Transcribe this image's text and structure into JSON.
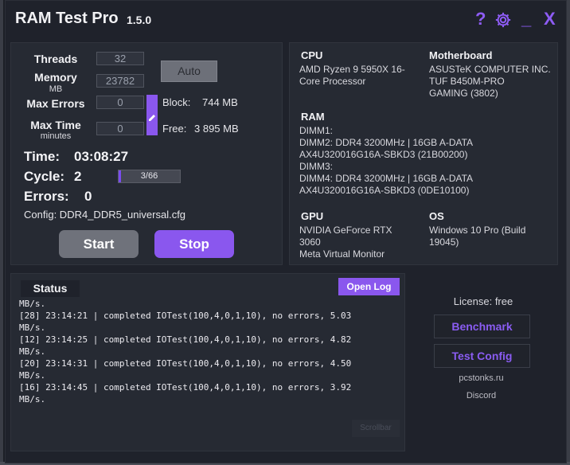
{
  "app": {
    "title": "RAM Test Pro",
    "version": "1.5.0",
    "accent": "#8a57ee",
    "icons": {
      "help": "?",
      "settings": "gear-icon",
      "minimize": "_",
      "close": "X"
    }
  },
  "controls": {
    "threads_label": "Threads",
    "threads_value": "32",
    "memory_label": "Memory",
    "memory_unit": "MB",
    "memory_value": "23782",
    "max_errors_label": "Max Errors",
    "max_errors_value": "0",
    "max_time_label": "Max Time",
    "max_time_unit": "minutes",
    "max_time_value": "0",
    "auto_label": "Auto",
    "block_label": "Block:",
    "block_value": "744 MB",
    "free_label": "Free:",
    "free_value": "3 895 MB"
  },
  "run": {
    "time_label": "Time:",
    "time_value": "03:08:27",
    "cycle_label": "Cycle:",
    "cycle_value": "2",
    "progress_text": "3/66",
    "progress_fraction": 0.045,
    "errors_label": "Errors:",
    "errors_value": "0",
    "config": "Config: DDR4_DDR5_universal.cfg",
    "start_label": "Start",
    "stop_label": "Stop"
  },
  "system": {
    "cpu_label": "CPU",
    "cpu_value": [
      "AMD Ryzen 9 5950X 16-",
      "Core Processor"
    ],
    "mb_label": "Motherboard",
    "mb_value": [
      "ASUSTeK COMPUTER INC.",
      "TUF B450M-PRO",
      "GAMING (3802)"
    ],
    "ram_label": "RAM",
    "ram_value": [
      "DIMM1:",
      "DIMM2: DDR4 3200MHz | 16GB A-DATA",
      "AX4U320016G16A-SBKD3 (21B00200)",
      "DIMM3:",
      "DIMM4: DDR4 3200MHz | 16GB A-DATA",
      "AX4U320016G16A-SBKD3 (0DE10100)"
    ],
    "gpu_label": "GPU",
    "gpu_value": [
      "NVIDIA GeForce RTX",
      "3060",
      "Meta Virtual Monitor"
    ],
    "os_label": "OS",
    "os_value": [
      "Windows 10 Pro (Build",
      "19045)"
    ]
  },
  "status": {
    "title": "Status",
    "open_log_label": "Open Log",
    "scrollbar_label": "Scrollbar",
    "log_lines": [
      "MB/s.",
      "[28] 23:14:21 | completed IOTest(100,4,0,1,10), no errors, 5.03",
      "MB/s.",
      "[12] 23:14:25 | completed IOTest(100,4,0,1,10), no errors, 4.82",
      "MB/s.",
      "[20] 23:14:31 | completed IOTest(100,4,0,1,10), no errors, 4.50",
      "MB/s.",
      "[16] 23:14:45 | completed IOTest(100,4,0,1,10), no errors, 3.92",
      "MB/s."
    ]
  },
  "sidebar": {
    "license": "License: free",
    "benchmark_label": "Benchmark",
    "test_config_label": "Test Config",
    "website": "pcstonks.ru",
    "discord": "Discord"
  }
}
